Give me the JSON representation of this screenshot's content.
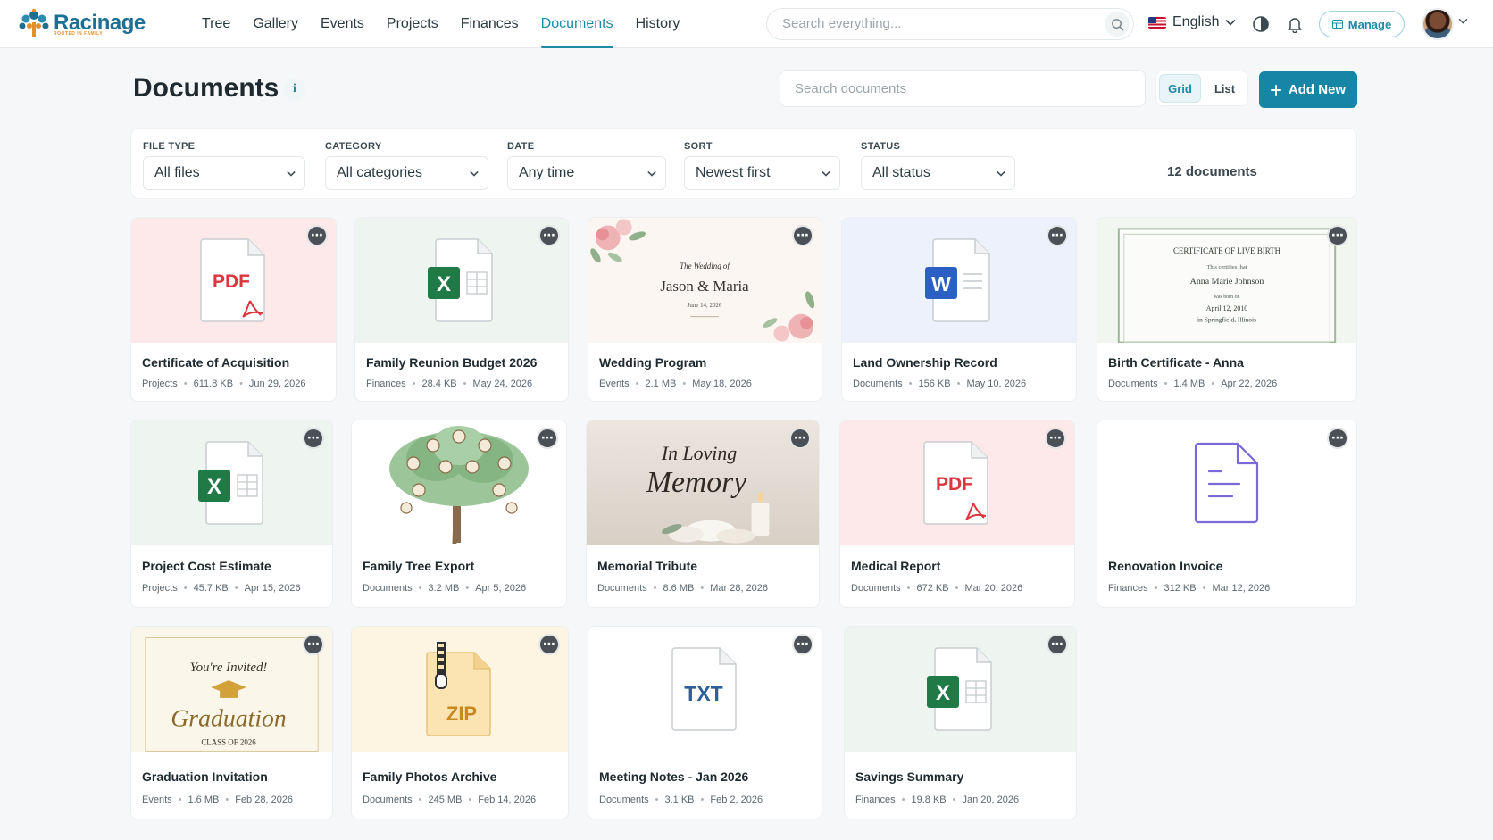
{
  "brand": {
    "name": "Racinage",
    "tagline": "ROOTED IN FAMILY"
  },
  "nav": [
    {
      "label": "Tree",
      "active": false
    },
    {
      "label": "Gallery",
      "active": false
    },
    {
      "label": "Events",
      "active": false
    },
    {
      "label": "Projects",
      "active": false
    },
    {
      "label": "Finances",
      "active": false
    },
    {
      "label": "Documents",
      "active": true
    },
    {
      "label": "History",
      "active": false
    }
  ],
  "global_search": {
    "placeholder": "Search everything..."
  },
  "language": {
    "label": "English"
  },
  "manage_label": "Manage",
  "page": {
    "title": "Documents",
    "info": "i"
  },
  "doc_search": {
    "placeholder": "Search documents"
  },
  "view": {
    "grid": "Grid",
    "list": "List",
    "selected": "Grid"
  },
  "add_new": "Add New",
  "filters": [
    {
      "label": "FILE TYPE",
      "value": "All files"
    },
    {
      "label": "CATEGORY",
      "value": "All categories"
    },
    {
      "label": "DATE",
      "value": "Any time"
    },
    {
      "label": "SORT",
      "value": "Newest first"
    },
    {
      "label": "STATUS",
      "value": "All status"
    }
  ],
  "doc_count": "12 documents",
  "documents": [
    {
      "title": "Certificate of Acquisition",
      "category": "Projects",
      "size": "611.8 KB",
      "date": "Jun 29, 2026",
      "kind": "pdf"
    },
    {
      "title": "Family Reunion Budget 2026",
      "category": "Finances",
      "size": "28.4 KB",
      "date": "May 24, 2026",
      "kind": "xls"
    },
    {
      "title": "Wedding Program",
      "category": "Events",
      "size": "2.1 MB",
      "date": "May 18, 2026",
      "kind": "wedding"
    },
    {
      "title": "Land Ownership Record",
      "category": "Documents",
      "size": "156 KB",
      "date": "May 10, 2026",
      "kind": "word"
    },
    {
      "title": "Birth Certificate - Anna",
      "category": "Documents",
      "size": "1.4 MB",
      "date": "Apr 22, 2026",
      "kind": "certificate"
    },
    {
      "title": "Project Cost Estimate",
      "category": "Projects",
      "size": "45.7 KB",
      "date": "Apr 15, 2026",
      "kind": "xls"
    },
    {
      "title": "Family Tree Export",
      "category": "Documents",
      "size": "3.2 MB",
      "date": "Apr 5, 2026",
      "kind": "tree"
    },
    {
      "title": "Memorial Tribute",
      "category": "Documents",
      "size": "8.6 MB",
      "date": "Mar 28, 2026",
      "kind": "memorial"
    },
    {
      "title": "Medical Report",
      "category": "Documents",
      "size": "672 KB",
      "date": "Mar 20, 2026",
      "kind": "pdf"
    },
    {
      "title": "Renovation Invoice",
      "category": "Finances",
      "size": "312 KB",
      "date": "Mar 12, 2026",
      "kind": "generic"
    },
    {
      "title": "Graduation Invitation",
      "category": "Events",
      "size": "1.6 MB",
      "date": "Feb 28, 2026",
      "kind": "graduation"
    },
    {
      "title": "Family Photos Archive",
      "category": "Documents",
      "size": "245 MB",
      "date": "Feb 14, 2026",
      "kind": "zip"
    },
    {
      "title": "Meeting Notes - Jan 2026",
      "category": "Documents",
      "size": "3.1 KB",
      "date": "Feb 2, 2026",
      "kind": "txt"
    },
    {
      "title": "Savings Summary",
      "category": "Finances",
      "size": "19.8 KB",
      "date": "Jan 20, 2026",
      "kind": "xls"
    }
  ],
  "thumb_text": {
    "pdf": "PDF",
    "xls": "X",
    "word": "W",
    "zip": "ZIP",
    "txt": "TXT",
    "wedding": {
      "line1": "The Wedding of",
      "names": "Jason & Maria",
      "date": "June 14, 2026"
    },
    "certificate": {
      "heading": "CERTIFICATE OF LIVE BIRTH",
      "line1": "This certifies that",
      "name": "Anna Marie Johnson",
      "line2": "was born on",
      "date": "April 12, 2010",
      "place": "in Springfield, Illinois"
    },
    "memorial": {
      "line1": "In Loving",
      "line2": "Memory"
    },
    "graduation": {
      "line1": "You're Invited!",
      "line2": "Graduation",
      "line3": "CLASS OF 2026"
    }
  },
  "colors": {
    "accent": "#1786a6",
    "pdf": "#d9363e",
    "excel": "#1f7a46",
    "word": "#2b5fc4",
    "txt": "#2d5f9a",
    "zip": "#c8891f",
    "generic": "#7a6ad8"
  }
}
